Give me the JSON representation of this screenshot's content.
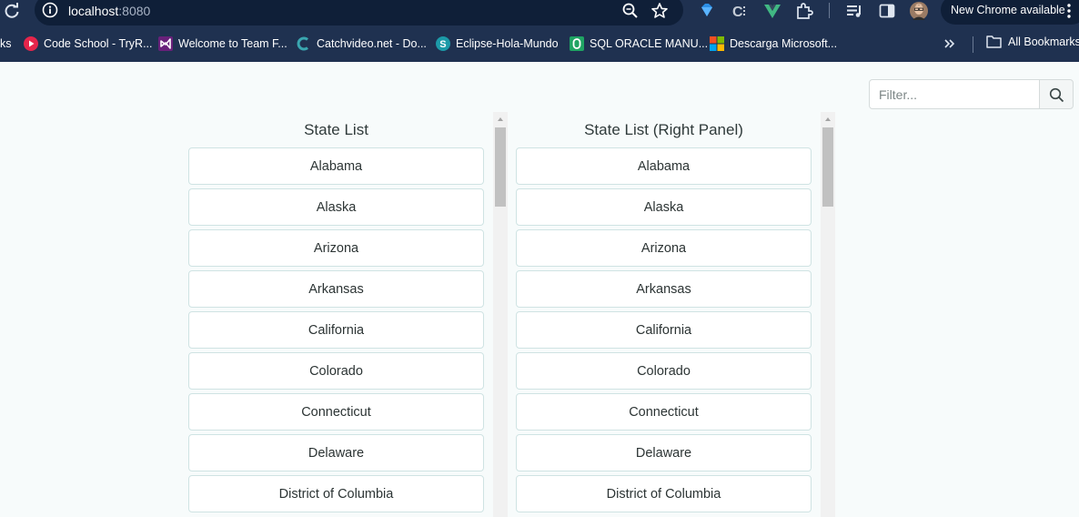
{
  "browser": {
    "url_host": "localhost",
    "url_port": ":8080",
    "new_chrome_label": "New Chrome available"
  },
  "bookmarks": {
    "partial_label": "ks",
    "items": [
      {
        "label": "Code School - TryR...",
        "icon": "code-school-favicon"
      },
      {
        "label": "Welcome to Team F...",
        "icon": "visual-studio-favicon"
      },
      {
        "label": "Catchvideo.net - Do...",
        "icon": "catchvideo-favicon"
      },
      {
        "label": "Eclipse-Hola-Mundo",
        "icon": "eclipse-favicon"
      },
      {
        "label": "SQL ORACLE MANU...",
        "icon": "sql-oracle-favicon"
      },
      {
        "label": "Descarga Microsoft...",
        "icon": "microsoft-favicon"
      }
    ],
    "all_bookmarks_label": "All Bookmarks"
  },
  "filter": {
    "placeholder": "Filter..."
  },
  "left_panel": {
    "title": "State List",
    "items": [
      "Alabama",
      "Alaska",
      "Arizona",
      "Arkansas",
      "California",
      "Colorado",
      "Connecticut",
      "Delaware",
      "District of Columbia"
    ]
  },
  "right_panel": {
    "title": "State List (Right Panel)",
    "items": [
      "Alabama",
      "Alaska",
      "Arizona",
      "Arkansas",
      "California",
      "Colorado",
      "Connecticut",
      "Delaware",
      "District of Columbia"
    ]
  },
  "colors": {
    "browser_chrome": "#1f3150",
    "page_background": "#f7fbfb",
    "item_border": "#cfe3e3"
  }
}
